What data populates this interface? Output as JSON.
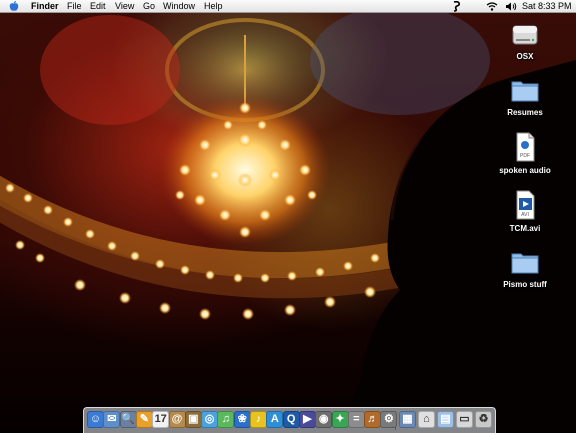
{
  "menubar": {
    "app_name": "Finder",
    "menus": [
      "File",
      "Edit",
      "View",
      "Go",
      "Window",
      "Help"
    ],
    "clock": "Sat 8:33 PM",
    "status_icons": [
      "script-menu-icon",
      "wifi-icon",
      "volume-icon"
    ]
  },
  "desktop": {
    "icons": [
      {
        "label": "OSX",
        "kind": "hard-drive-icon"
      },
      {
        "label": "Resumes",
        "kind": "folder-icon"
      },
      {
        "label": "spoken audio",
        "kind": "pdf-document-icon",
        "badge": "PDF"
      },
      {
        "label": "TCM.avi",
        "kind": "video-file-icon",
        "badge": "AVI"
      },
      {
        "label": "Pismo stuff",
        "kind": "folder-icon"
      }
    ]
  },
  "dock": {
    "apps": [
      {
        "name": "finder-icon",
        "color": "#3a7bd5",
        "glyph": "☺"
      },
      {
        "name": "mail-icon",
        "color": "#5f8fc9",
        "glyph": "✉"
      },
      {
        "name": "sherlock-icon",
        "color": "#6b7fa0",
        "glyph": "🔍"
      },
      {
        "name": "paint-icon",
        "color": "#e9a02a",
        "glyph": "✎"
      },
      {
        "name": "calendar-icon",
        "color": "#f2f2f2",
        "glyph": "17"
      },
      {
        "name": "address-book-icon",
        "color": "#b58a4b",
        "glyph": "@"
      },
      {
        "name": "preview-icon",
        "color": "#8a6d3b",
        "glyph": "▣"
      },
      {
        "name": "safari-icon",
        "color": "#4aa3df",
        "glyph": "◎"
      },
      {
        "name": "itunes-icon",
        "color": "#5cb85c",
        "glyph": "♫"
      },
      {
        "name": "iphoto-icon",
        "color": "#2a6fc9",
        "glyph": "❀"
      },
      {
        "name": "garageband-icon",
        "color": "#e8c21f",
        "glyph": "♪"
      },
      {
        "name": "ichat-icon",
        "color": "#2f8fd6",
        "glyph": "A"
      },
      {
        "name": "quicktime-icon",
        "color": "#1e5aa8",
        "glyph": "Q"
      },
      {
        "name": "imovie-icon",
        "color": "#4a4a9a",
        "glyph": "▶"
      },
      {
        "name": "idvd-icon",
        "color": "#6e6e6e",
        "glyph": "◉"
      },
      {
        "name": "bird-app-icon",
        "color": "#3aa655",
        "glyph": "✦"
      },
      {
        "name": "calculator-icon",
        "color": "#8c8c8c",
        "glyph": "="
      },
      {
        "name": "guitar-app-icon",
        "color": "#b06a2a",
        "glyph": "♬"
      },
      {
        "name": "system-preferences-icon",
        "color": "#7a7a7a",
        "glyph": "⚙"
      }
    ],
    "docs": [
      {
        "name": "image-document-icon",
        "color": "#6a8ab5",
        "glyph": "▦"
      },
      {
        "name": "home-folder-icon",
        "color": "#e0e0e0",
        "glyph": "⌂"
      },
      {
        "name": "applications-folder-icon",
        "color": "#9cc0e6",
        "glyph": "▤"
      },
      {
        "name": "window-minimized-icon",
        "color": "#d8d8d8",
        "glyph": "▭"
      },
      {
        "name": "trash-icon",
        "color": "#c9c9c9",
        "glyph": "♻"
      }
    ]
  }
}
